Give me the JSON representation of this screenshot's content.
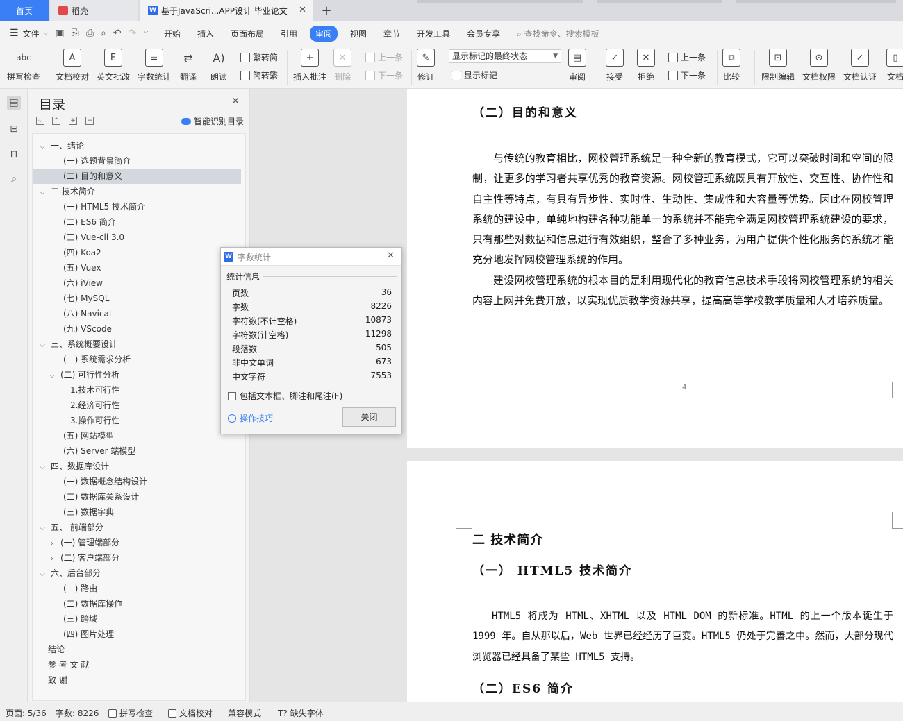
{
  "tabs": {
    "home": "首页",
    "daoke": "稻壳",
    "doc": "基于JavaScri...APP设计 毕业论文"
  },
  "menu": {
    "file": "文件",
    "items": [
      "开始",
      "插入",
      "页面布局",
      "引用",
      "审阅",
      "视图",
      "章节",
      "开发工具",
      "会员专享"
    ],
    "active_index": 4,
    "search": "查找命令、搜索模板"
  },
  "ribbon": {
    "spell_check": "拼写检查",
    "doc_proof": "文档校对",
    "eng_review": "英文批改",
    "word_count": "字数统计",
    "translate": "翻译",
    "read_aloud": "朗读",
    "to_trad": "繁转简",
    "to_simp": "简转繁",
    "insert_comment": "插入批注",
    "delete": "删除",
    "prev": "上一条",
    "next": "下一条",
    "track": "修订",
    "markup_state": "显示标记的最终状态",
    "show_markup": "显示标记",
    "review": "审阅",
    "accept": "接受",
    "reject": "拒绝",
    "prev2": "上一条",
    "next2": "下一条",
    "compare": "比较",
    "restrict": "限制编辑",
    "permission": "文档权限",
    "certify": "文档认证",
    "more": "文档"
  },
  "toc": {
    "title": "目录",
    "smart": "智能识别目录",
    "items": [
      {
        "label": "一、绪论",
        "caret": "v",
        "indent": 0
      },
      {
        "label": "(一) 选题背景简介",
        "caret": "",
        "indent": 1
      },
      {
        "label": "(二) 目的和意义",
        "caret": "",
        "indent": 1,
        "selected": true
      },
      {
        "label": "二 技术简介",
        "caret": "v",
        "indent": 0
      },
      {
        "label": "(一)   HTML5 技术简介",
        "caret": "",
        "indent": 1
      },
      {
        "label": "(二) ES6 简介",
        "caret": "",
        "indent": 1
      },
      {
        "label": "(三) Vue-cli 3.0",
        "caret": "",
        "indent": 1
      },
      {
        "label": "(四) Koa2",
        "caret": "",
        "indent": 1
      },
      {
        "label": "(五) Vuex",
        "caret": "",
        "indent": 1
      },
      {
        "label": "(六) iView",
        "caret": "",
        "indent": 1
      },
      {
        "label": "(七) MySQL",
        "caret": "",
        "indent": 1
      },
      {
        "label": "(八) Navicat",
        "caret": "",
        "indent": 1
      },
      {
        "label": "(九) VScode",
        "caret": "",
        "indent": 1
      },
      {
        "label": "三、系统概要设计",
        "caret": "v",
        "indent": 0
      },
      {
        "label": "(一) 系统需求分析",
        "caret": "",
        "indent": 1
      },
      {
        "label": "(二) 可行性分析",
        "caret": "v",
        "indent": 1
      },
      {
        "label": "1.技术可行性",
        "caret": "",
        "indent": 2
      },
      {
        "label": "2.经济可行性",
        "caret": "",
        "indent": 2
      },
      {
        "label": "3.操作可行性",
        "caret": "",
        "indent": 2
      },
      {
        "label": "(五)   网站模型",
        "caret": "",
        "indent": 1
      },
      {
        "label": "(六) Server 端模型",
        "caret": "",
        "indent": 1
      },
      {
        "label": "四、数据库设计",
        "caret": "v",
        "indent": 0
      },
      {
        "label": "(一) 数据概念结构设计",
        "caret": "",
        "indent": 1
      },
      {
        "label": "(二) 数据库关系设计",
        "caret": "",
        "indent": 1
      },
      {
        "label": "(三) 数据字典",
        "caret": "",
        "indent": 1
      },
      {
        "label": "五、  前端部分",
        "caret": "v",
        "indent": 0
      },
      {
        "label": "(一) 管理端部分",
        "caret": ">",
        "indent": 1
      },
      {
        "label": "(二) 客户端部分",
        "caret": ">",
        "indent": 1
      },
      {
        "label": "六、后台部分",
        "caret": "v",
        "indent": 0
      },
      {
        "label": "(一) 路由",
        "caret": "",
        "indent": 1
      },
      {
        "label": "(二)   数据库操作",
        "caret": "",
        "indent": 1
      },
      {
        "label": "(三) 跨域",
        "caret": "",
        "indent": 1
      },
      {
        "label": "(四) 图片处理",
        "caret": "",
        "indent": 1
      },
      {
        "label": "结论",
        "caret": "",
        "indent": 0
      },
      {
        "label": "参 考 文 献",
        "caret": "",
        "indent": 0
      },
      {
        "label": "致  谢",
        "caret": "",
        "indent": 0
      }
    ]
  },
  "dialog": {
    "title": "字数统计",
    "section": "统计信息",
    "stats": [
      {
        "label": "页数",
        "value": "36"
      },
      {
        "label": "字数",
        "value": "8226"
      },
      {
        "label": "字符数(不计空格)",
        "value": "10873"
      },
      {
        "label": "字符数(计空格)",
        "value": "11298"
      },
      {
        "label": "段落数",
        "value": "505"
      },
      {
        "label": "非中文单词",
        "value": "673"
      },
      {
        "label": "中文字符",
        "value": "7553"
      }
    ],
    "checkbox": "包括文本框、脚注和尾注(F)",
    "tips": "操作技巧",
    "close": "关闭"
  },
  "document": {
    "page1": {
      "heading": "（二）目的和意义",
      "para1": "与传统的教育相比，网校管理系统是一种全新的教育模式，它可以突破时间和空间的限制，让更多的学习者共享优秀的教育资源。网校管理系统既具有开放性、交互性、协作性和自主性等特点，有具有异步性、实时性、生动性、集成性和大容量等优势。因此在网校管理系统的建设中，单纯地构建各种功能单一的系统并不能完全满足网校管理系统建设的要求，只有那些对数据和信息进行有效组织，整合了多种业务，为用户提供个性化服务的系统才能充分地发挥网校管理系统的作用。",
      "para2": "建设网校管理系统的根本目的是利用现代化的教育信息技术手段将网校管理系统的相关内容上网并免费开放，以实现优质教学资源共享，提高高等学校教学质量和人才培养质量。",
      "page_number": "4"
    },
    "page2": {
      "chapter": "二 技术简介",
      "section1": "（一） HTML5 技术简介",
      "para1": "HTML5 将成为 HTML、XHTML 以及 HTML DOM 的新标准。HTML 的上一个版本诞生于 1999 年。自从那以后，Web 世界已经经历了巨变。HTML5 仍处于完善之中。然而，大部分现代浏览器已经具备了某些 HTML5 支持。",
      "section2": "（二）ES6 简介"
    }
  },
  "status": {
    "page": "页面: 5/36",
    "words": "字数: 8226",
    "spell": "拼写检查",
    "proof": "文档校对",
    "compat": "兼容模式",
    "missing_font": "缺失字体"
  },
  "colors": {
    "accent": "#3a7ff6",
    "selected_row": "#d3d7de"
  }
}
